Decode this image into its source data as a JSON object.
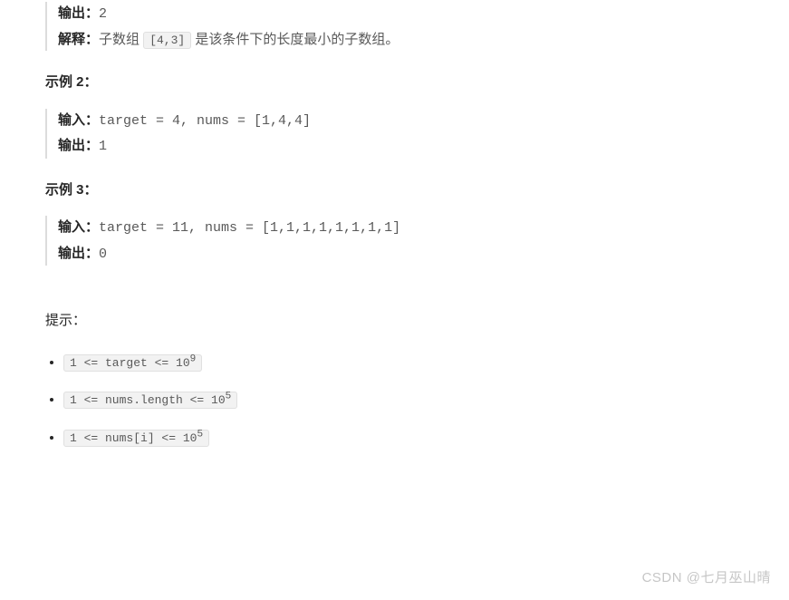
{
  "example1": {
    "output_label": "输出：",
    "output_value": "2",
    "explain_label": "解释：",
    "explain_prefix": "子数组 ",
    "explain_code": "[4,3]",
    "explain_suffix": " 是该条件下的长度最小的子数组。"
  },
  "heading2": "示例 2：",
  "example2": {
    "input_label": "输入：",
    "input_value": "target = 4, nums = [1,4,4]",
    "output_label": "输出：",
    "output_value": "1"
  },
  "heading3": "示例 3：",
  "example3": {
    "input_label": "输入：",
    "input_value": "target = 11, nums = [1,1,1,1,1,1,1,1]",
    "output_label": "输出：",
    "output_value": "0"
  },
  "hints_heading": "提示：",
  "hints": {
    "h1_base": "1 <= target <= 10",
    "h1_exp": "9",
    "h2_base": "1 <= nums.length <= 10",
    "h2_exp": "5",
    "h3_base": "1 <= nums[i] <= 10",
    "h3_exp": "5"
  },
  "watermark": "CSDN @七月巫山晴"
}
